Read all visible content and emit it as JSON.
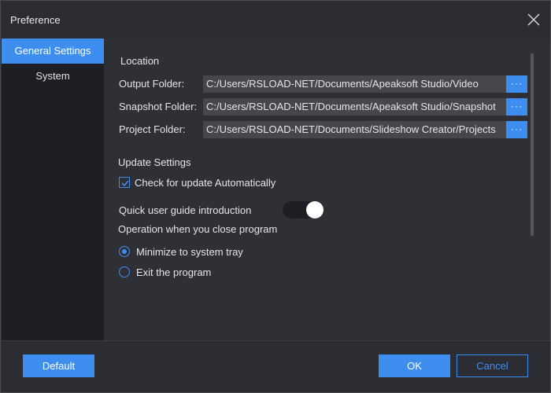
{
  "window": {
    "title": "Preference"
  },
  "sidebar": {
    "items": [
      {
        "label": "General Settings",
        "active": true
      },
      {
        "label": "System",
        "active": false
      }
    ]
  },
  "location": {
    "title": "Location",
    "folders": [
      {
        "label": "Output Folder:",
        "path": "C:/Users/RSLOAD-NET/Documents/Apeaksoft Studio/Video",
        "button": "···"
      },
      {
        "label": "Snapshot Folder:",
        "path": "C:/Users/RSLOAD-NET/Documents/Apeaksoft Studio/Snapshot",
        "button": "···"
      },
      {
        "label": "Project Folder:",
        "path": "C:/Users/RSLOAD-NET/Documents/Slideshow Creator/Projects",
        "button": "···"
      }
    ]
  },
  "update": {
    "title": "Update Settings",
    "auto_check_label": "Check for update Automatically",
    "auto_check": true
  },
  "guide": {
    "label": "Quick user guide introduction",
    "enabled": true
  },
  "close_behavior": {
    "title": "Operation when you close program",
    "options": [
      {
        "label": "Minimize to system tray",
        "selected": true
      },
      {
        "label": "Exit the program",
        "selected": false
      }
    ]
  },
  "footer": {
    "default_label": "Default",
    "ok_label": "OK",
    "cancel_label": "Cancel"
  },
  "colors": {
    "accent": "#3e8ef0",
    "background": "#2b2d33",
    "sidebar": "#1d1f24"
  }
}
